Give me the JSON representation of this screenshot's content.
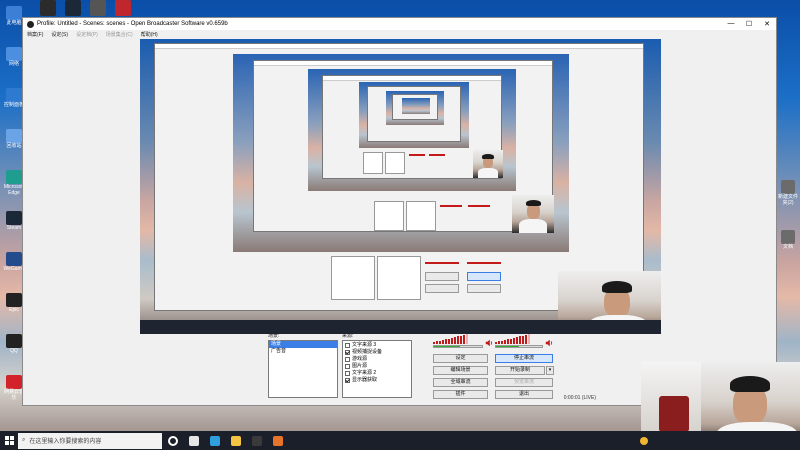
{
  "desktop": {
    "left_icons": [
      {
        "label": "此电脑",
        "color": "#3b7fd6"
      },
      {
        "label": "网络",
        "color": "#4c8fe0"
      },
      {
        "label": "控制面板",
        "color": "#2e7ad1"
      },
      {
        "label": "回收站",
        "color": "#6aa4e6"
      },
      {
        "label": "Microsoft Edge",
        "color": "#1f9d8f"
      },
      {
        "label": "Steam",
        "color": "#1b2838"
      },
      {
        "label": "WeGame",
        "color": "#244c8c"
      },
      {
        "label": "Epic",
        "color": "#222222"
      },
      {
        "label": "QQ",
        "color": "#222222"
      },
      {
        "label": "网易云音乐",
        "color": "#d2232a"
      }
    ],
    "top_icons": [
      {
        "label": "OBS",
        "color": "#2b2b2b"
      },
      {
        "label": "Steam",
        "color": "#1b2838"
      },
      {
        "label": "Game",
        "color": "#555555"
      },
      {
        "label": "App",
        "color": "#c0272d"
      }
    ],
    "right_icons": [
      {
        "label": "新建文件夹(2)"
      },
      {
        "label": "文档"
      }
    ]
  },
  "obs": {
    "title": "Profile: Untitled - Scenes: scenes - Open Broadcaster Software v0.659b",
    "window_controls": {
      "minimize": "—",
      "maximize": "☐",
      "close": "✕"
    },
    "menu": [
      "档案(F)",
      "设定(S)",
      "设定档(P)",
      "场景集合(C)",
      "帮助(H)"
    ],
    "scenes_label": "场景:",
    "scenes": [
      "场景",
      "广告音"
    ],
    "sources_label": "来源:",
    "sources": [
      {
        "label": "文字来源 3",
        "checked": false
      },
      {
        "label": "视频捕捉设备",
        "checked": true
      },
      {
        "label": "游戏源",
        "checked": false
      },
      {
        "label": "图片源",
        "checked": false
      },
      {
        "label": "文字来源 2",
        "checked": false
      },
      {
        "label": "显示器获取",
        "checked": true
      }
    ],
    "mixer": {
      "mic_level": 0.55,
      "desktop_level": 0.5
    },
    "buttons": {
      "settings": "设定",
      "stop_preview": "停止串流",
      "edit_scene": "编辑场景",
      "start_recording": "开始录制",
      "fullscreen_preview": "全域串流",
      "test_stream": "预览串流",
      "plugins": "插件",
      "exit": "退出"
    },
    "status": "0:00:01  (LIVE)"
  },
  "taskbar": {
    "search_placeholder": "在这里输入你要搜索的内容",
    "apps": [
      {
        "name": "cortana",
        "color": "#ffffff"
      },
      {
        "name": "task-view",
        "color": "#e6e6e6"
      },
      {
        "name": "edge",
        "color": "#2f9fe0"
      },
      {
        "name": "file-explorer",
        "color": "#f4c542"
      },
      {
        "name": "obs",
        "color": "#3a3a3a"
      },
      {
        "name": "app-orange",
        "color": "#e8742a"
      }
    ],
    "tray_color": "#f2b632"
  }
}
